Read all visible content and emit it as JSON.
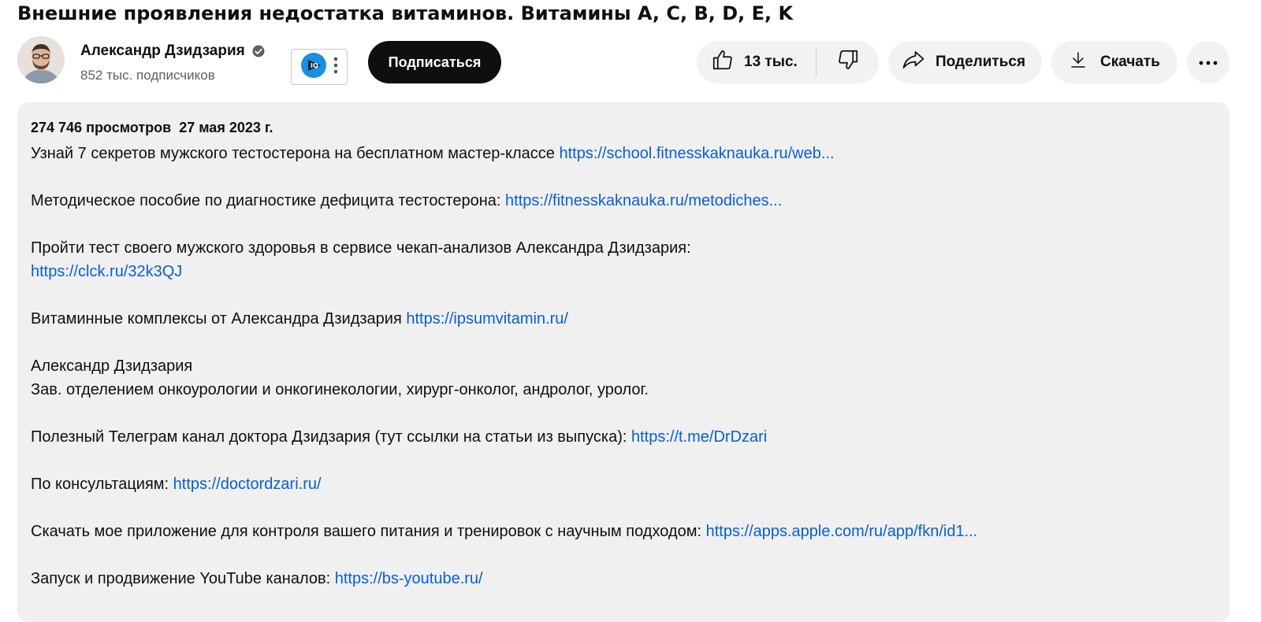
{
  "video": {
    "title": "Внешние проявления недостатка витаминов. Витамины A, C, B, D, E, K"
  },
  "channel": {
    "name": "Александр Дзидзария",
    "subscribers": "852 тыс. подписчиков",
    "avatar_icon": "avatar-photo",
    "verified_icon": "verified-checkmark-icon"
  },
  "widget": {
    "badge_text": "IQ"
  },
  "actions": {
    "subscribe": "Подписаться",
    "likes": "13 тыс.",
    "share": "Поделиться",
    "download": "Скачать"
  },
  "description": {
    "views": "274 746 просмотров",
    "date": "27 мая 2023 г.",
    "p1_text": "Узнай 7 секретов мужского тестостерона на бесплатном мастер-классе ",
    "p1_link": "https://school.fitnesskaknauka.ru/web...",
    "p2_text": "Методическое пособие по диагностике дефицита тестостерона: ",
    "p2_link": "https://fitnesskaknauka.ru/metodiches...",
    "p3_text": "Пройти тест своего мужского здоровья в сервисе чекап-анализов Александра Дзидзария:",
    "p3_link": "https://clck.ru/32k3QJ",
    "p4_text": "Витаминные комплексы от Александра Дзидзария ",
    "p4_link": "https://ipsumvitamin.ru/",
    "p5_name": "Александр Дзидзария",
    "p5_role": "Зав. отделением онкоурологии и онкогинекологии, хирург-онколог, андролог, уролог.",
    "p6_text": "Полезный Телеграм канал доктора Дзидзария (тут ссылки на статьи из выпуска): ",
    "p6_link": "https://t.me/DrDzari",
    "p7_text": "По консультациям: ",
    "p7_link": "https://doctordzari.ru/",
    "p8_text": "Скачать мое приложение для контроля вашего питания и тренировок с научным подходом: ",
    "p8_link": "https://apps.apple.com/ru/app/fkn/id1...",
    "p9_text": "Запуск и продвижение YouTube каналов: ",
    "p9_link": "https://bs-youtube.ru/"
  },
  "colors": {
    "link": "#065fd4",
    "subscribe_bg": "#0f0f0f",
    "pill_bg": "#f2f2f2",
    "description_bg": "#f0f0f0"
  }
}
